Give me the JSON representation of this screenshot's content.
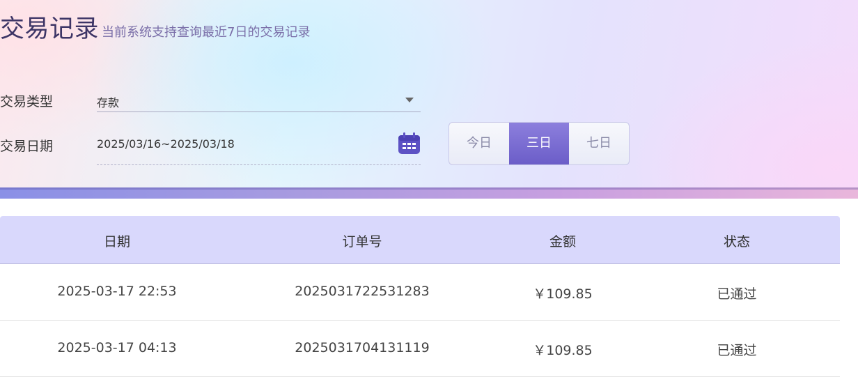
{
  "header": {
    "title": "交易记录",
    "subtitle": "当前系统支持查询最近7日的交易记录"
  },
  "filters": {
    "type_label": "交易类型",
    "type_value": "存款",
    "date_label": "交易日期",
    "date_value": "2025/03/16~2025/03/18"
  },
  "range_buttons": [
    {
      "label": "今日",
      "active": false
    },
    {
      "label": "三日",
      "active": true
    },
    {
      "label": "七日",
      "active": false
    }
  ],
  "table": {
    "headers": [
      "日期",
      "订单号",
      "金额",
      "状态"
    ],
    "rows": [
      [
        "2025-03-17 22:53",
        "2025031722531283",
        "￥109.85",
        "已通过"
      ],
      [
        "2025-03-17 04:13",
        "2025031704131119",
        "￥109.85",
        "已通过"
      ]
    ]
  },
  "colors": {
    "accent": "#7466d0",
    "table_header_bg": "#d9d8fc"
  },
  "icons": {
    "dropdown": "caret-down-icon",
    "calendar": "calendar-icon"
  }
}
